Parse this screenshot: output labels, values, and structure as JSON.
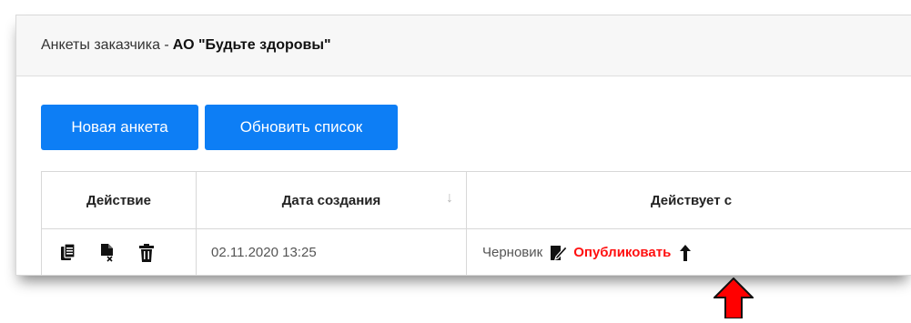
{
  "header": {
    "prefix": "Анкеты заказчика - ",
    "company": "АО \"Будьте здоровы\""
  },
  "toolbar": {
    "new_label": "Новая анкета",
    "refresh_label": "Обновить список"
  },
  "table": {
    "columns": [
      "Действие",
      "Дата создания",
      "Действует с"
    ],
    "sort_indicator": "↓",
    "rows": [
      {
        "created": "02.11.2020 13:25",
        "status": "Черновик",
        "publish_label": "Опубликовать",
        "action_icons": [
          "copy-icon",
          "delete-file-icon",
          "trash-icon"
        ]
      }
    ]
  },
  "colors": {
    "primary": "#0d7ef5",
    "publish": "#ff1010",
    "annotation_arrow": "#ff0000"
  }
}
